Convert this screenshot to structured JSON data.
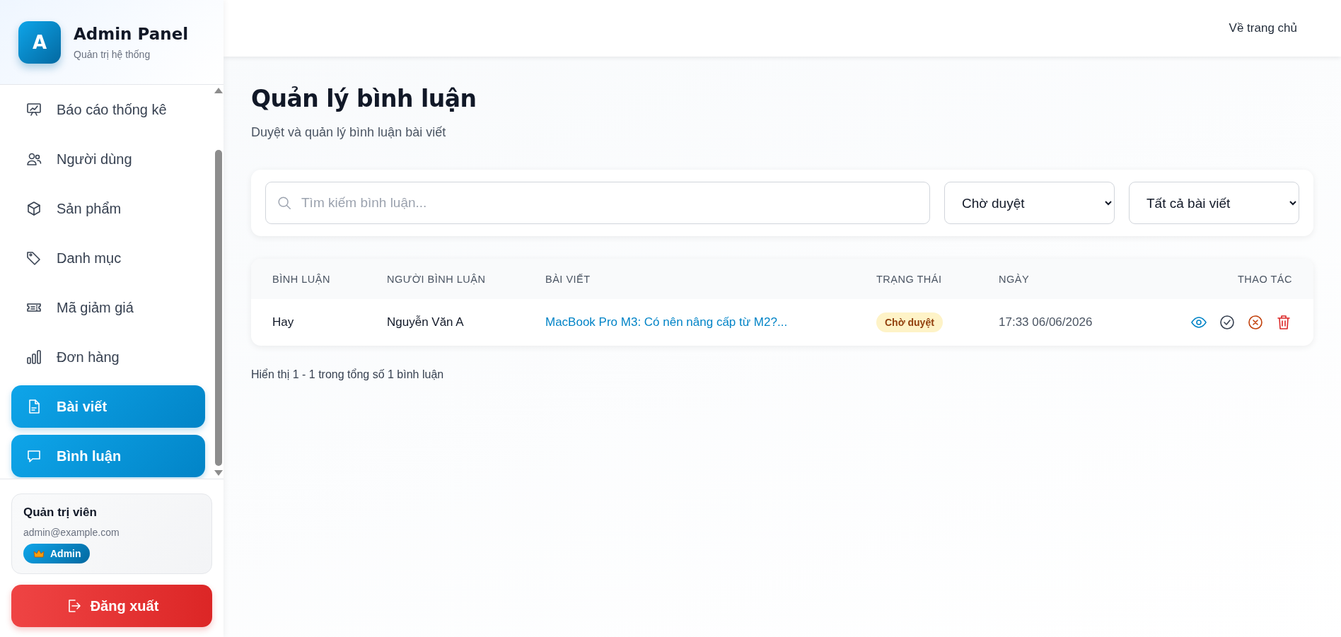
{
  "brand": {
    "logo_letter": "A",
    "title": "Admin Panel",
    "subtitle": "Quản trị hệ thống"
  },
  "sidebar": {
    "items": [
      {
        "label": "Báo cáo thống kê",
        "selected": false
      },
      {
        "label": "Người dùng",
        "selected": false
      },
      {
        "label": "Sản phẩm",
        "selected": false
      },
      {
        "label": "Danh mục",
        "selected": false
      },
      {
        "label": "Mã giảm giá",
        "selected": false
      },
      {
        "label": "Đơn hàng",
        "selected": false
      },
      {
        "label": "Bài viết",
        "selected": true
      },
      {
        "label": "Bình luận",
        "selected": true
      }
    ]
  },
  "user": {
    "name": "Quản trị viên",
    "email": "admin@example.com",
    "role": "Admin"
  },
  "logout": "Đăng xuất",
  "topbar": {
    "link": "Về trang chủ"
  },
  "page": {
    "title": "Quản lý bình luận",
    "subtitle": "Duyệt và quản lý bình luận bài viết"
  },
  "filters": {
    "search": {
      "placeholder": "Tìm kiếm bình luận..."
    },
    "status": {
      "value": "Chờ duyệt"
    },
    "post": {
      "value": "Tất cả bài viết"
    }
  },
  "table": {
    "columns": [
      "BÌNH LUẬN",
      "NGƯỜI BÌNH LUẬN",
      "BÀI VIẾT",
      "TRẠNG THÁI",
      "NGÀY",
      "THAO TÁC"
    ],
    "rows": [
      {
        "comment": "Hay",
        "author": "Nguyễn Văn A",
        "post": "MacBook Pro M3: Có nên nâng cấp từ M2?...",
        "status": "Chờ duyệt",
        "date": "17:33 06/06/2026"
      }
    ]
  },
  "summary": "Hiển thị 1 - 1 trong tổng số 1 bình luận"
}
